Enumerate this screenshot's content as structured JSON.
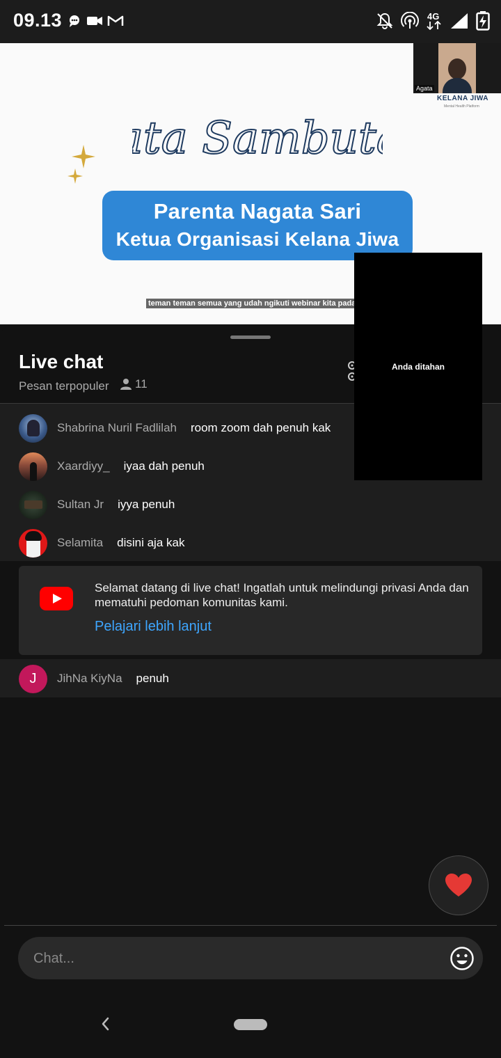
{
  "status_bar": {
    "time": "09.13",
    "network": "4G",
    "left_icons": [
      "chat-bubble-icon",
      "video-camera-icon",
      "gmail-icon"
    ],
    "right_icons": [
      "notifications-off-icon",
      "hotspot-icon",
      "network-4g-icon",
      "signal-icon",
      "battery-charging-icon"
    ]
  },
  "video": {
    "slide_title": "Kata Sambutan",
    "slide_box_line1": "Parenta Nagata Sari",
    "slide_box_line2": "Ketua Organisasi Kelana Jiwa",
    "caption": "teman teman semua yang udah ngikuti webinar kita pada",
    "participant_label": "Agata",
    "brand": "KELANA JIWA",
    "brand_sub": "Mental Health Platform"
  },
  "chat": {
    "title": "Live chat",
    "subtitle": "Pesan terpopuler",
    "viewer_count": "11",
    "messages": [
      {
        "author": "Shabrina Nuril Fadlilah",
        "text": "room zoom dah penuh kak"
      },
      {
        "author": "Xaardiyy_",
        "text": "iyaa dah penuh"
      },
      {
        "author": "Sultan Jr",
        "text": "iyya penuh"
      },
      {
        "author": "Selamita",
        "text": "disini aja kak"
      }
    ],
    "welcome": {
      "text": "Selamat datang di live chat! Ingatlah untuk melindungi privasi Anda dan mematuhi pedoman komunitas kami.",
      "link": "Pelajari lebih lanjut"
    },
    "last_message": {
      "author": "JihNa KiyNa",
      "text": "penuh",
      "avatar_letter": "J"
    },
    "input_placeholder": "Chat..."
  },
  "pip": {
    "text": "Anda ditahan"
  },
  "colors": {
    "accent_link": "#3ea6ff",
    "youtube_red": "#ff0000",
    "heart": "#e53935",
    "avatar_j": "#c2185b"
  }
}
